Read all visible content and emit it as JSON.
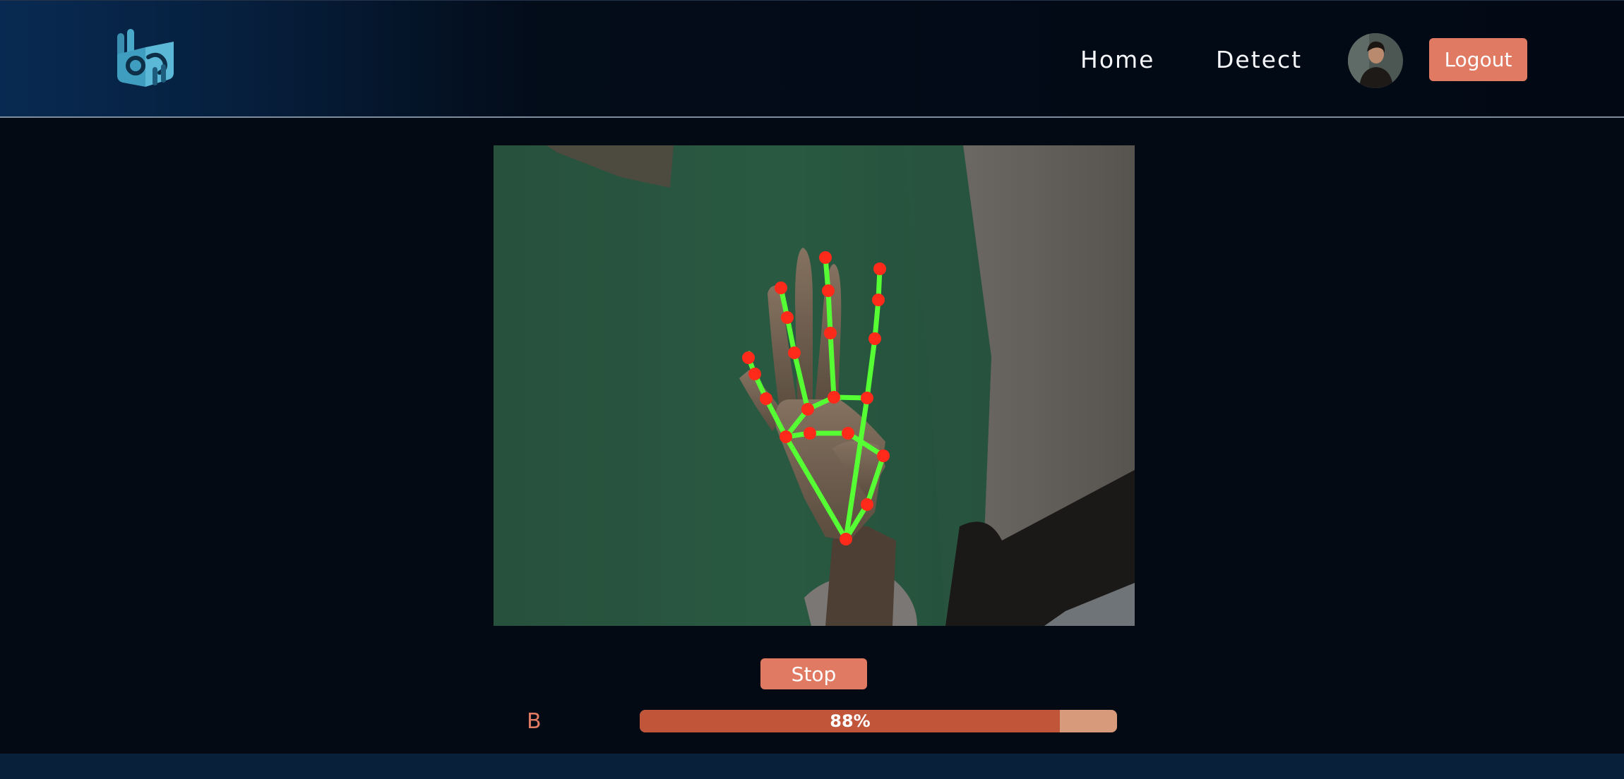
{
  "header": {
    "logo_icon": "hand-sign-logo-icon",
    "nav": [
      {
        "label": "Home"
      },
      {
        "label": "Detect"
      }
    ],
    "avatar_icon": "user-avatar",
    "logout_label": "Logout"
  },
  "camera": {
    "feed_icon": "webcam-feed-hand-landmarks"
  },
  "controls": {
    "stop_label": "Stop"
  },
  "prediction": {
    "letter": "B",
    "confidence": 0.88,
    "confidence_label": "88%"
  },
  "colors": {
    "accent": "#e07a62",
    "background": "#030a14",
    "progress_fill": "#c0553a",
    "progress_track": "#d79a7b",
    "landmark_point": "#ff2a1a",
    "landmark_line": "#55ff33"
  }
}
